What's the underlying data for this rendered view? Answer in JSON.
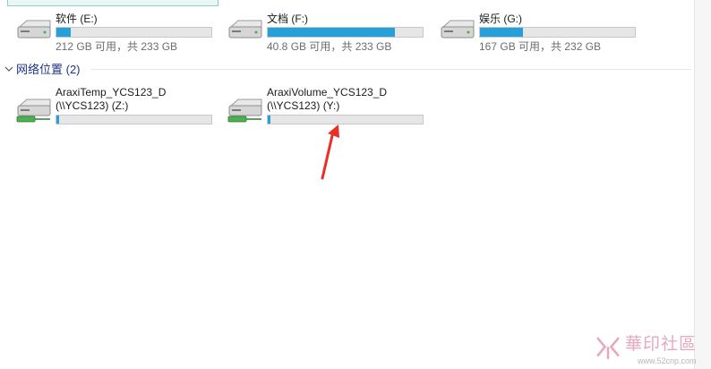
{
  "drives": [
    {
      "label": "软件 (E:)",
      "status": "212 GB 可用，共 233 GB",
      "used_fraction": 0.09
    },
    {
      "label": "文档 (F:)",
      "status": "40.8 GB 可用，共 233 GB",
      "used_fraction": 0.82
    },
    {
      "label": "娱乐 (G:)",
      "status": "167 GB 可用，共 232 GB",
      "used_fraction": 0.28
    }
  ],
  "network_group": {
    "title": "网络位置 (2)"
  },
  "network_drives": [
    {
      "name": "AraxiTemp_YCS123_D",
      "path": "(\\\\YCS123) (Z:)",
      "used_fraction": 0.01
    },
    {
      "name": "AraxiVolume_YCS123_D",
      "path": "(\\\\YCS123) (Y:)",
      "used_fraction": 0.01
    }
  ],
  "watermark": {
    "text": "華印社區",
    "url": "www.52cnp.com"
  },
  "colors": {
    "bar_fill": "#26a0da",
    "bar_track": "#e6e6e6",
    "group_title": "#1e3287",
    "arrow": "#e8302a"
  }
}
